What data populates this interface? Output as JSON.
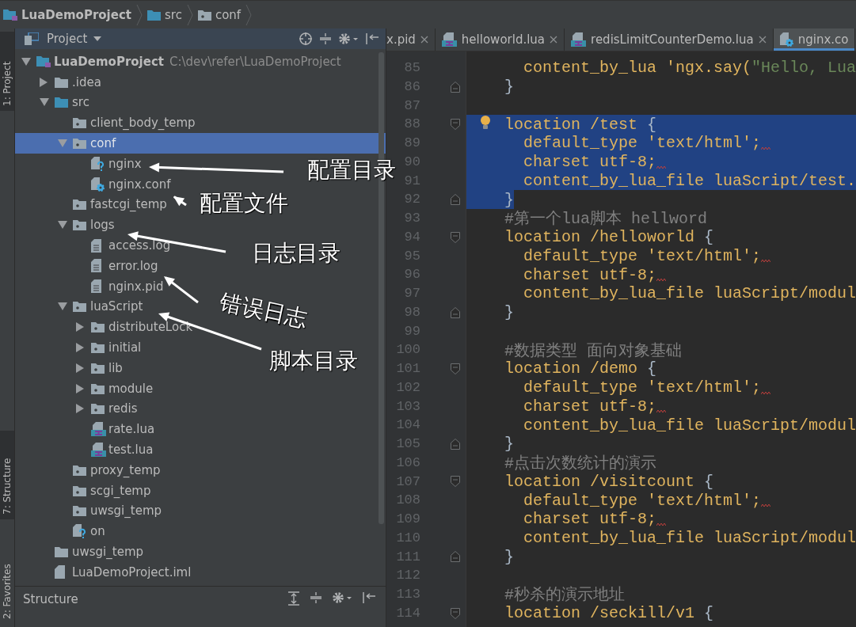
{
  "breadcrumbs": [
    {
      "label": "LuaDemoProject",
      "kind": "project"
    },
    {
      "label": "src",
      "kind": "source-folder"
    },
    {
      "label": "conf",
      "kind": "folder"
    }
  ],
  "side_tabs": [
    {
      "label": "1: Project",
      "selected": true
    },
    {
      "label": "7: Structure",
      "selected": true
    },
    {
      "label": "2: Favorites",
      "selected": false
    }
  ],
  "project_panel": {
    "title": "Project",
    "tree": [
      {
        "label": "LuaDemoProject",
        "path": "C:\\dev\\refer\\LuaDemoProject",
        "kind": "project",
        "expanded": true,
        "selected": false,
        "children": [
          {
            "label": ".idea",
            "kind": "plain-folder",
            "expanded": false,
            "selected": false
          },
          {
            "label": "src",
            "kind": "source-folder",
            "expanded": true,
            "selected": false,
            "children": [
              {
                "label": "client_body_temp",
                "kind": "folder",
                "selected": false
              },
              {
                "label": "conf",
                "kind": "folder",
                "expanded": true,
                "selected": true,
                "children": [
                  {
                    "label": "nginx",
                    "kind": "unknown-file",
                    "selected": false
                  },
                  {
                    "label": "nginx.conf",
                    "kind": "config-file",
                    "selected": false
                  }
                ]
              },
              {
                "label": "fastcgi_temp",
                "kind": "folder",
                "selected": false
              },
              {
                "label": "logs",
                "kind": "folder",
                "expanded": true,
                "selected": false,
                "children": [
                  {
                    "label": "access.log",
                    "kind": "text-file",
                    "selected": false
                  },
                  {
                    "label": "error.log",
                    "kind": "text-file",
                    "selected": false
                  },
                  {
                    "label": "nginx.pid",
                    "kind": "text-file",
                    "selected": false
                  }
                ]
              },
              {
                "label": "luaScript",
                "kind": "folder",
                "expanded": true,
                "selected": false,
                "children": [
                  {
                    "label": "distributeLock",
                    "kind": "folder",
                    "expanded": false,
                    "selected": false
                  },
                  {
                    "label": "initial",
                    "kind": "folder",
                    "expanded": false,
                    "selected": false
                  },
                  {
                    "label": "lib",
                    "kind": "folder",
                    "expanded": false,
                    "selected": false
                  },
                  {
                    "label": "module",
                    "kind": "folder",
                    "expanded": false,
                    "selected": false
                  },
                  {
                    "label": "redis",
                    "kind": "folder",
                    "expanded": false,
                    "selected": false
                  },
                  {
                    "label": "rate.lua",
                    "kind": "lua-file",
                    "selected": false
                  },
                  {
                    "label": "test.lua",
                    "kind": "lua-file",
                    "selected": false
                  }
                ]
              },
              {
                "label": "proxy_temp",
                "kind": "folder",
                "selected": false
              },
              {
                "label": "scgi_temp",
                "kind": "folder",
                "selected": false
              },
              {
                "label": "uwsgi_temp",
                "kind": "folder",
                "selected": false
              },
              {
                "label": "on",
                "kind": "unknown-file",
                "selected": false
              }
            ]
          },
          {
            "label": "uwsgi_temp",
            "kind": "plain-folder",
            "selected": false
          },
          {
            "label": "LuaDemoProject.iml",
            "kind": "plain-file",
            "selected": false
          }
        ]
      }
    ]
  },
  "structure_panel": {
    "title": "Structure"
  },
  "editor": {
    "tabs": [
      {
        "label": "x.pid",
        "selected": false,
        "closable": true
      },
      {
        "label": "helloworld.lua",
        "kind": "lua-file",
        "selected": false,
        "closable": true
      },
      {
        "label": "redisLimitCounterDemo.lua",
        "kind": "lua-file",
        "selected": false,
        "closable": true
      },
      {
        "label": "nginx.co",
        "kind": "config-file",
        "selected": true,
        "closable": false
      }
    ],
    "lines": [
      {
        "number": "85",
        "code": [
          {
            "text": "  content_by_lua 'ngx.say(",
            "kind": "keyword"
          },
          {
            "text": "\"Hello, Lua",
            "kind": "string"
          }
        ]
      },
      {
        "number": "86",
        "kind": "fold-end",
        "code": [
          {
            "text": "}",
            "kind": "brace"
          }
        ]
      },
      {
        "number": "87"
      },
      {
        "number": "88",
        "kind": "fold-start",
        "intention": true,
        "selected": true,
        "code": [
          {
            "text": "location /test ",
            "kind": "keyword"
          },
          {
            "text": "{",
            "kind": "brace"
          }
        ]
      },
      {
        "number": "89",
        "selected": true,
        "warning": true,
        "code": [
          {
            "text": "  default_type 'text/html';",
            "kind": "keyword"
          }
        ]
      },
      {
        "number": "90",
        "selected": true,
        "warning": true,
        "code": [
          {
            "text": "  charset utf-8;",
            "kind": "keyword"
          }
        ]
      },
      {
        "number": "91",
        "selected": true,
        "code": [
          {
            "text": "  content_by_lua_file luaScript/test.",
            "kind": "keyword"
          }
        ]
      },
      {
        "number": "92",
        "kind": "fold-end",
        "selected": true,
        "code": [
          {
            "text": "}",
            "kind": "brace"
          }
        ]
      },
      {
        "number": "93",
        "code": [
          {
            "text": "#第一个lua脚本 hellword",
            "kind": "comment"
          }
        ]
      },
      {
        "number": "94",
        "kind": "fold-start",
        "code": [
          {
            "text": "location /helloworld ",
            "kind": "keyword"
          },
          {
            "text": "{",
            "kind": "brace"
          }
        ]
      },
      {
        "number": "95",
        "warning": true,
        "code": [
          {
            "text": "  default_type 'text/html';",
            "kind": "keyword"
          }
        ]
      },
      {
        "number": "96",
        "warning": true,
        "code": [
          {
            "text": "  charset utf-8;",
            "kind": "keyword"
          }
        ]
      },
      {
        "number": "97",
        "code": [
          {
            "text": "  content_by_lua_file luaScript/modul",
            "kind": "keyword"
          }
        ]
      },
      {
        "number": "98",
        "kind": "fold-end",
        "code": [
          {
            "text": "}",
            "kind": "brace"
          }
        ]
      },
      {
        "number": "99"
      },
      {
        "number": "100",
        "code": [
          {
            "text": "#数据类型 面向对象基础",
            "kind": "comment"
          }
        ]
      },
      {
        "number": "101",
        "kind": "fold-start",
        "code": [
          {
            "text": "location /demo ",
            "kind": "keyword"
          },
          {
            "text": "{",
            "kind": "brace"
          }
        ]
      },
      {
        "number": "102",
        "warning": true,
        "code": [
          {
            "text": "  default_type 'text/html';",
            "kind": "keyword"
          }
        ]
      },
      {
        "number": "103",
        "warning": true,
        "code": [
          {
            "text": "  charset utf-8;",
            "kind": "keyword"
          }
        ]
      },
      {
        "number": "104",
        "code": [
          {
            "text": "  content_by_lua_file luaScript/modul",
            "kind": "keyword"
          }
        ]
      },
      {
        "number": "105",
        "kind": "fold-end",
        "code": [
          {
            "text": "}",
            "kind": "brace"
          }
        ]
      },
      {
        "number": "106",
        "code": [
          {
            "text": "#点击次数统计的演示",
            "kind": "comment"
          }
        ]
      },
      {
        "number": "107",
        "kind": "fold-start",
        "code": [
          {
            "text": "location /visitcount ",
            "kind": "keyword"
          },
          {
            "text": "{",
            "kind": "brace"
          }
        ]
      },
      {
        "number": "108",
        "warning": true,
        "code": [
          {
            "text": "  default_type 'text/html';",
            "kind": "keyword"
          }
        ]
      },
      {
        "number": "109",
        "warning": true,
        "code": [
          {
            "text": "  charset utf-8;",
            "kind": "keyword"
          }
        ]
      },
      {
        "number": "110",
        "code": [
          {
            "text": "  content_by_lua_file luaScript/modul",
            "kind": "keyword"
          }
        ]
      },
      {
        "number": "111",
        "kind": "fold-end",
        "code": [
          {
            "text": "}",
            "kind": "brace"
          }
        ]
      },
      {
        "number": "112"
      },
      {
        "number": "113",
        "code": [
          {
            "text": "#秒杀的演示地址",
            "kind": "comment"
          }
        ]
      },
      {
        "number": "114",
        "kind": "fold-start",
        "code": [
          {
            "text": "location /seckill/v1 ",
            "kind": "keyword"
          },
          {
            "text": "{",
            "kind": "brace"
          }
        ]
      }
    ]
  },
  "annotations": [
    {
      "text": "配置目录"
    },
    {
      "text": "配置文件"
    },
    {
      "text": "日志目录"
    },
    {
      "text": "错误日志"
    },
    {
      "text": "脚本目录"
    }
  ]
}
